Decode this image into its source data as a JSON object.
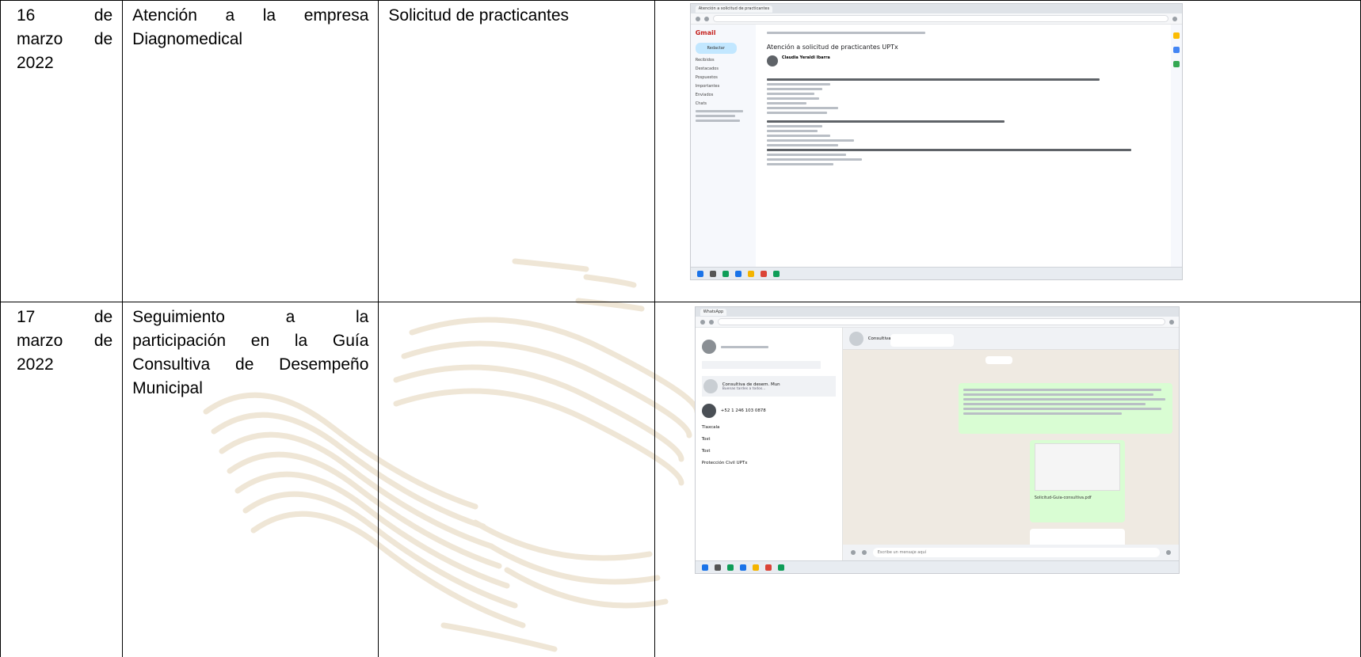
{
  "rows": [
    {
      "date": {
        "day": "16",
        "de1": "de",
        "month": "marzo",
        "de2": "de",
        "year": "2022"
      },
      "activity_lines": [
        [
          "Atención",
          "a",
          "la",
          "empresa"
        ],
        [
          "Diagnomedical"
        ]
      ],
      "description": "Solicitud de practicantes",
      "evidence": {
        "type": "gmail",
        "app_name": "Gmail",
        "tab_title": "Atención a solicitud de practicantes",
        "compose_label": "Redactar",
        "subject": "Atención a solicitud de practicantes UPTx",
        "sender": "Claudia Yeraldi Ibarra",
        "sidebar_items": [
          "Recibidos",
          "Destacados",
          "Pospuestos",
          "Importantes",
          "Enviados",
          "Chats"
        ]
      }
    },
    {
      "date": {
        "day": "17",
        "de1": "de",
        "month": "marzo",
        "de2": "de",
        "year": "2022"
      },
      "activity_lines": [
        [
          "Seguimiento",
          "a",
          "la"
        ],
        [
          "participación",
          "en",
          "la",
          "Guía"
        ],
        [
          "Consultiva",
          "de",
          "Desempeño"
        ],
        [
          "Municipal"
        ]
      ],
      "description": "",
      "evidence": {
        "type": "whatsapp",
        "tab_title": "WhatsApp",
        "chat_title": "Consultiva de desem. Mun",
        "contacts": [
          {
            "name": "Consultiva de desem. Mun",
            "preview": "Buenas tardes a todos..."
          },
          {
            "name": "+52 1 246 103 0878",
            "preview": ""
          },
          {
            "name": "Tlaxcala",
            "preview": ""
          },
          {
            "name": "Tost",
            "preview": ""
          },
          {
            "name": "Tost",
            "preview": ""
          },
          {
            "name": "Protección Civil UPTx",
            "preview": ""
          }
        ],
        "input_placeholder": "Escribe un mensaje aquí",
        "attachment_name": "Solicitud-Guia-consultiva.pdf"
      }
    }
  ]
}
